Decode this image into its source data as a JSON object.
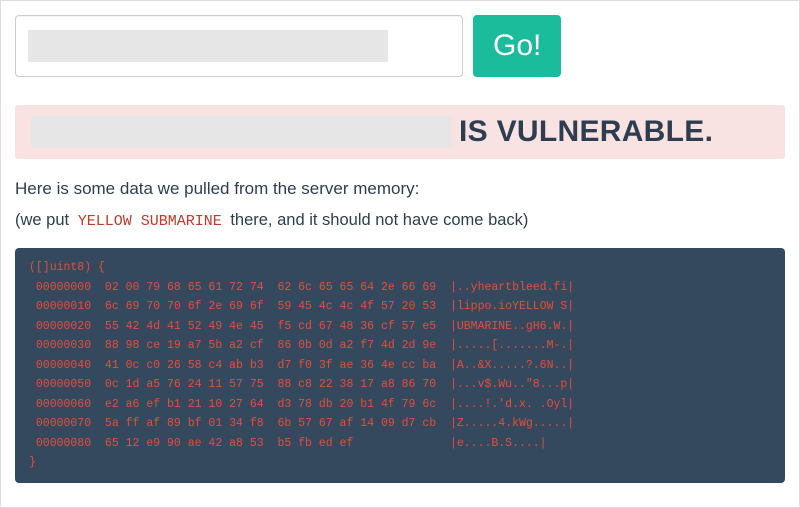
{
  "form": {
    "host_value": "",
    "host_placeholder": "",
    "go_label": "Go!"
  },
  "alert": {
    "host_display": "",
    "vulnerable_text": "IS VULNERABLE."
  },
  "intro_text": "Here is some data we pulled from the server memory:",
  "subnote": {
    "prefix": "(we put ",
    "code": "YELLOW SUBMARINE",
    "suffix": " there, and it should not have come back)"
  },
  "hexdump_text": "([]uint8) {\n 00000000  02 00 79 68 65 61 72 74  62 6c 65 65 64 2e 66 69  |..yheartbleed.fi|\n 00000010  6c 69 70 70 6f 2e 69 6f  59 45 4c 4c 4f 57 20 53  |lippo.ioYELLOW S|\n 00000020  55 42 4d 41 52 49 4e 45  f5 cd 67 48 36 cf 57 e5  |UBMARINE..gH6.W.|\n 00000030  88 98 ce 19 a7 5b a2 cf  86 0b 0d a2 f7 4d 2d 9e  |.....[.......M-.|\n 00000040  41 0c c0 26 58 c4 ab b3  d7 f0 3f ae 36 4e cc ba  |A..&X.....?.6N..|\n 00000050  0c 1d a5 76 24 11 57 75  88 c8 22 38 17 a8 86 70  |...v$.Wu..\"8...p|\n 00000060  e2 a6 ef b1 21 10 27 64  d3 78 db 20 b1 4f 79 6c  |....!.'d.x. .Oyl|\n 00000070  5a ff af 89 bf 01 34 f8  6b 57 67 af 14 09 d7 cb  |Z.....4.kWg.....|\n 00000080  65 12 e9 90 ae 42 a8 53  b5 fb ed ef              |e....B.S....|\n}"
}
